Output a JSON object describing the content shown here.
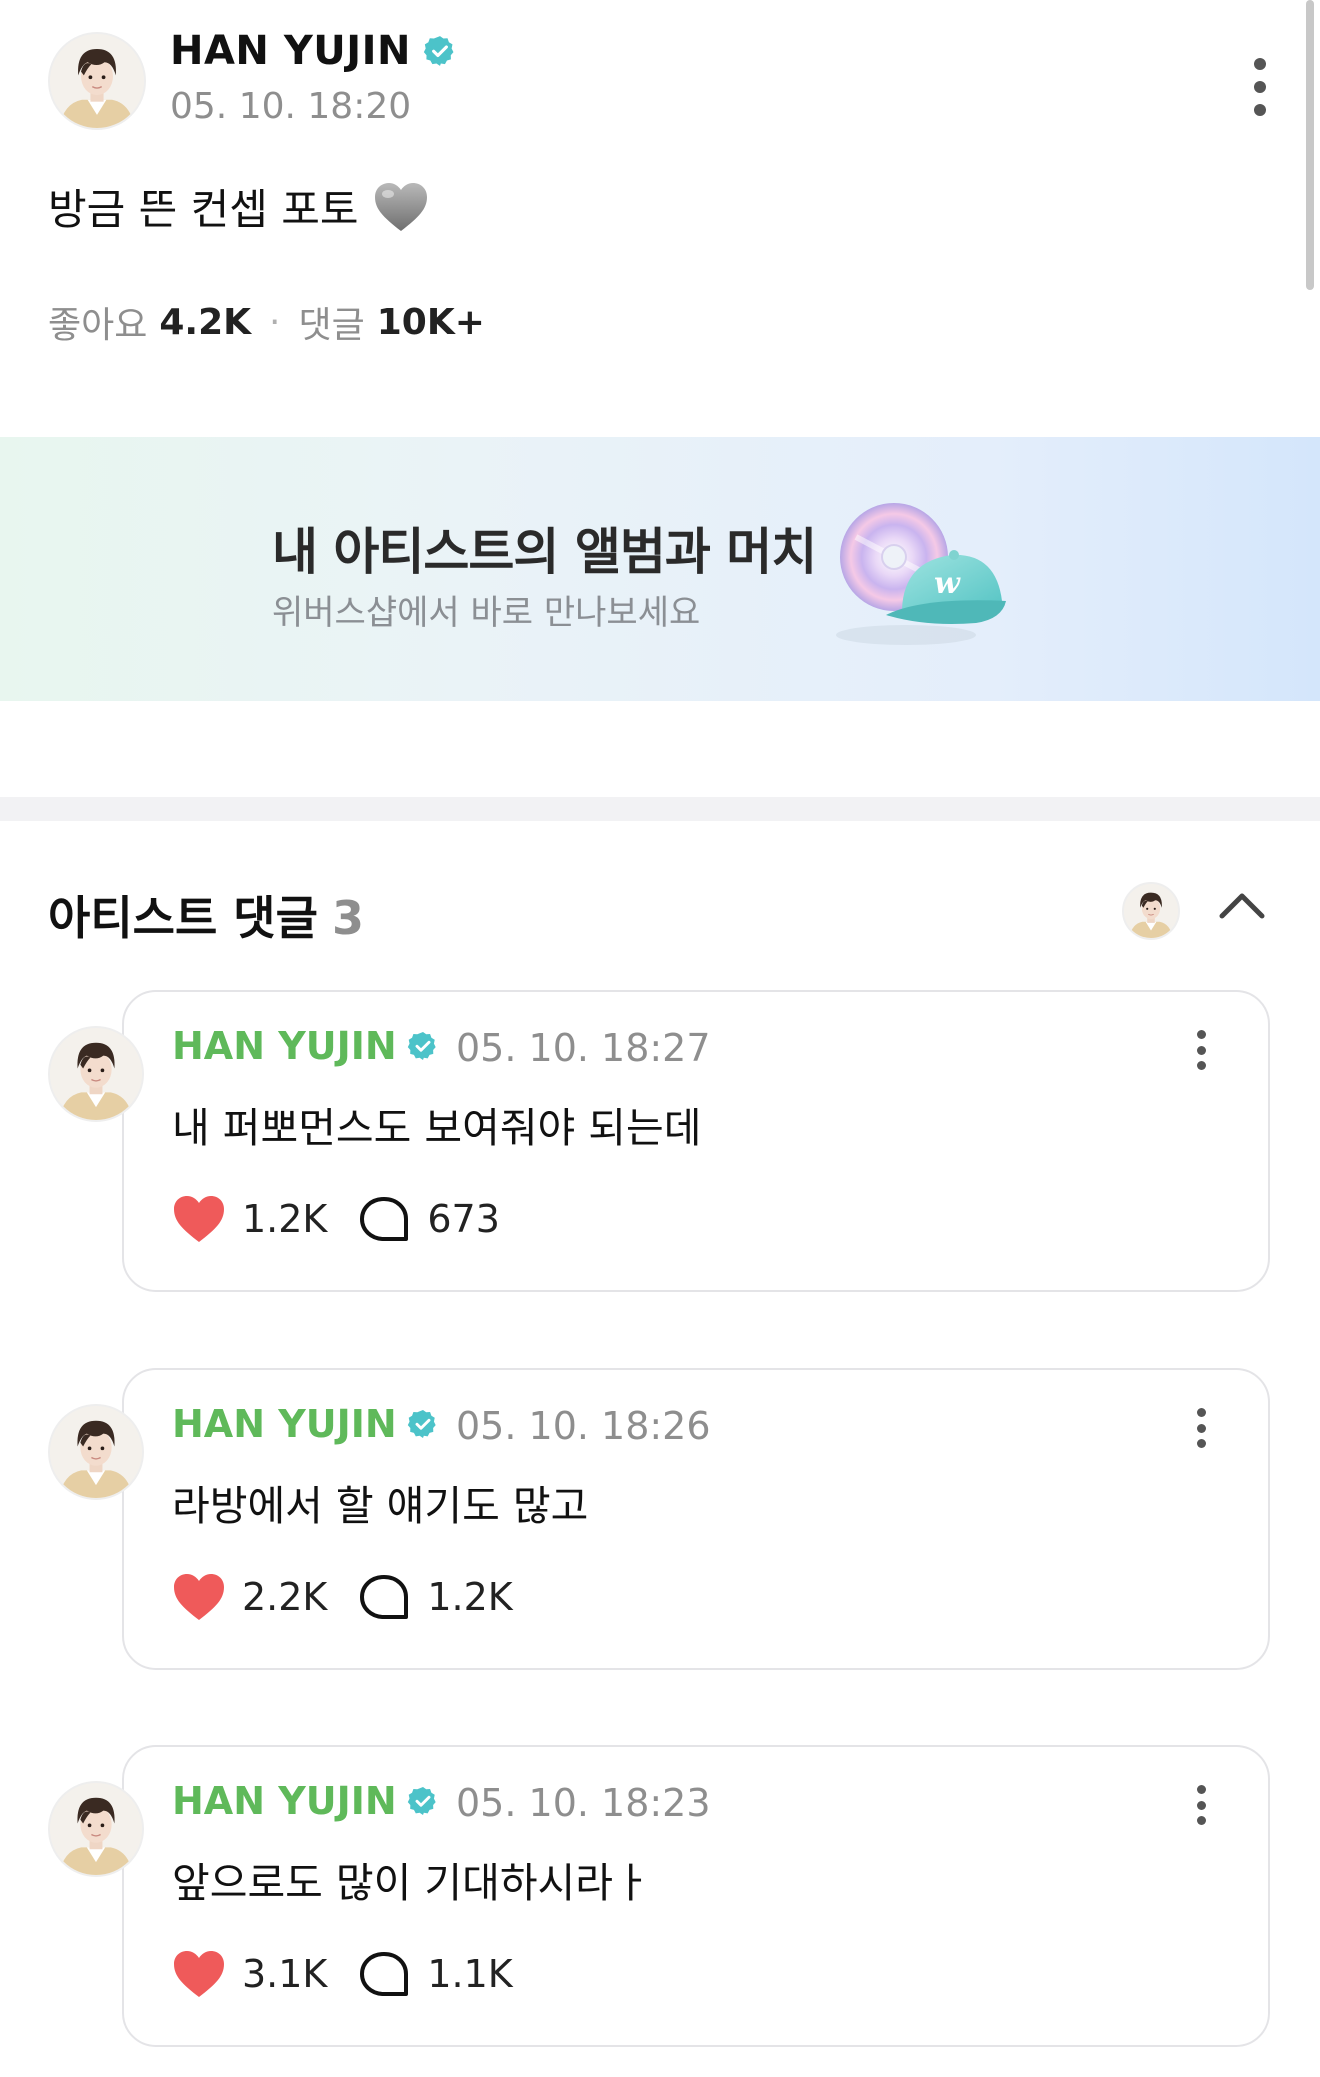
{
  "post": {
    "author": "HAN YUJIN",
    "time": "05. 10. 18:20",
    "text": "방금 뜬 컨셉 포토",
    "likes_label": "좋아요",
    "likes": "4.2K",
    "comments_label": "댓글",
    "comments": "10K+"
  },
  "banner": {
    "title": "내 아티스트의 앨범과 머치",
    "subtitle": "위버스샵에서 바로 만나보세요"
  },
  "artist_comments": {
    "title": "아티스트 댓글",
    "count": "3",
    "items": [
      {
        "author": "HAN YUJIN",
        "time": "05. 10. 18:27",
        "text": "내 퍼뽀먼스도 보여줘야 되는데",
        "likes": "1.2K",
        "replies": "673"
      },
      {
        "author": "HAN YUJIN",
        "time": "05. 10. 18:26",
        "text": "라방에서 할 얘기도 많고",
        "likes": "2.2K",
        "replies": "1.2K"
      },
      {
        "author": "HAN YUJIN",
        "time": "05. 10. 18:23",
        "text": "앞으로도 많이 기대하시라ㅏ",
        "likes": "3.1K",
        "replies": "1.1K"
      }
    ]
  },
  "icons": {
    "verified": "verified-badge-icon",
    "post_heart": "gray-heart-emoji",
    "like": "heart-icon",
    "reply": "speech-bubble-icon",
    "more": "more-vertical-icon",
    "collapse": "chevron-up-icon"
  },
  "colors": {
    "verified": "#4cc3c9",
    "artist_name": "#5fb95a",
    "like_heart": "#ef5a5a",
    "muted_text": "#8e8e8e"
  }
}
